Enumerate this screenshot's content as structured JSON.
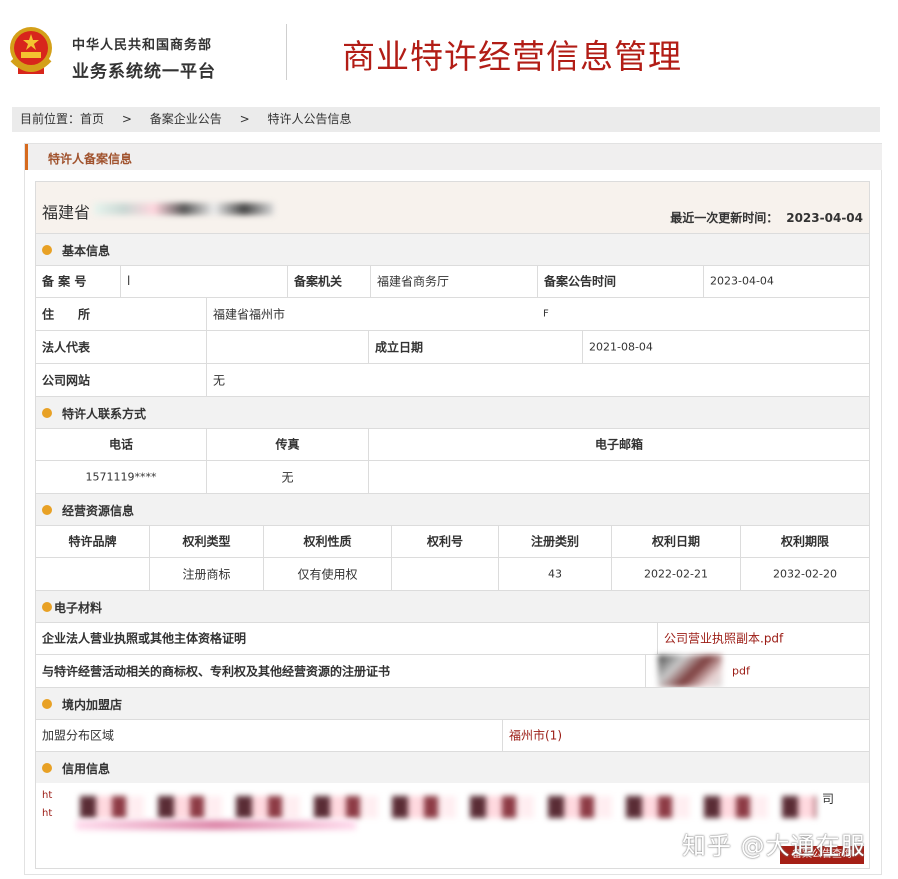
{
  "header": {
    "org_line1": "中华人民共和国商务部",
    "org_line2": "业务系统统一平台",
    "system_title": "商业特许经营信息管理"
  },
  "breadcrumb": {
    "prefix": "目前位置：",
    "items": [
      "首页",
      "备案企业公告",
      "特许人公告信息"
    ],
    "separator": ">"
  },
  "panel": {
    "title": "特许人备案信息",
    "company_name": "福建省",
    "last_update_label": "最近一次更新时间：",
    "last_update_value": "2023-04-04"
  },
  "basic_info": {
    "title": "基本信息",
    "record_no_label": "备 案 号",
    "record_no_value": "l",
    "record_org_label": "备案机关",
    "record_org_value": "福建省商务厅",
    "announce_time_label": "备案公告时间",
    "announce_time_value": "2023-04-04",
    "address_label": "住　　所",
    "address_value": "福建省福州市",
    "address_tail": "F",
    "legal_rep_label": "法人代表",
    "legal_rep_value": "",
    "founded_label": "成立日期",
    "founded_value": "2021-08-04",
    "website_label": "公司网站",
    "website_value": "无"
  },
  "contact": {
    "title": "特许人联系方式",
    "headers": [
      "电话",
      "传真",
      "电子邮箱"
    ],
    "phone": "1571119****",
    "fax": "无",
    "email": ""
  },
  "resources": {
    "title": "经营资源信息",
    "headers": [
      "特许品牌",
      "权利类型",
      "权利性质",
      "权利号",
      "注册类别",
      "权利日期",
      "权利期限"
    ],
    "rows": [
      [
        "",
        "注册商标",
        "仅有使用权",
        "",
        "43",
        "2022-02-21",
        "2032-02-20"
      ]
    ]
  },
  "materials": {
    "title": "电子材料",
    "items": [
      {
        "label": "企业法人营业执照或其他主体资格证明",
        "file": "公司营业执照副本.pdf"
      },
      {
        "label": "与特许经营活动相关的商标权、专利权及其他经营资源的注册证书",
        "file": "pdf"
      }
    ]
  },
  "stores": {
    "title": "境内加盟店",
    "region_label": "加盟分布区域",
    "region_value": "福州市(1)"
  },
  "credit": {
    "title": "信用信息",
    "line1_prefix": "ht",
    "line2_prefix": "ht",
    "line1_suffix": "司",
    "button_label": "备案公告查询"
  },
  "watermark": "知乎 @大通在服",
  "colors": {
    "brand_red": "#b21d16",
    "section_dot": "#e8a125",
    "panel_accent": "#d66a1e",
    "link_red": "#9b1b14"
  }
}
